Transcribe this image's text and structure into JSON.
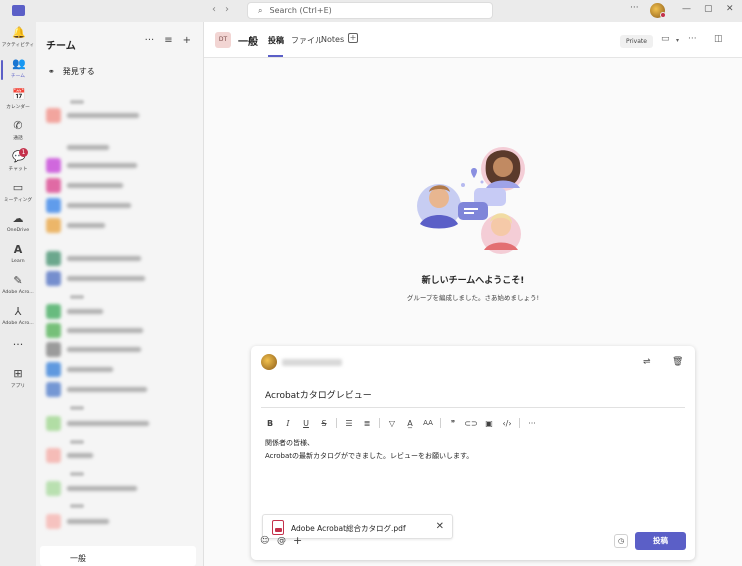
{
  "search": {
    "placeholder": "Search (Ctrl+E)"
  },
  "window": {
    "more": "···",
    "minimize": "—",
    "maximize": "▢",
    "close": "✕"
  },
  "appbar": [
    {
      "label": "アクティビティ",
      "icon": "bell-icon",
      "glyph": "🔔"
    },
    {
      "label": "チーム",
      "icon": "teams-icon",
      "glyph": "👥",
      "active": true
    },
    {
      "label": "カレンダー",
      "icon": "calendar-icon",
      "glyph": "📅"
    },
    {
      "label": "通話",
      "icon": "phone-icon",
      "glyph": "✆"
    },
    {
      "label": "チャット",
      "icon": "chat-icon",
      "glyph": "💬",
      "badge": "1"
    },
    {
      "label": "ミーティング",
      "icon": "video-icon",
      "glyph": "▭"
    },
    {
      "label": "OneDrive",
      "icon": "cloud-icon",
      "glyph": "☁"
    },
    {
      "label": "Learn",
      "icon": "learn-icon",
      "glyph": "A"
    },
    {
      "label": "Adobe Acro...",
      "icon": "adobe-acrobat-icon",
      "glyph": "✎"
    },
    {
      "label": "Adobe Acro...",
      "icon": "adobe-acrobat-icon",
      "glyph": "⅄"
    },
    {
      "label": "",
      "icon": "more-apps-icon",
      "glyph": "···"
    },
    {
      "label": "アプリ",
      "icon": "apps-icon",
      "glyph": "⊞"
    }
  ],
  "teams_panel": {
    "title": "チーム",
    "more": "···",
    "filter": "≡",
    "add": "+",
    "discover": "発見する",
    "selected_channel": "一般"
  },
  "header": {
    "initials": "DT",
    "channel": "一般",
    "tabs": [
      "投稿",
      "ファイル",
      "Notes"
    ],
    "tab_add": "+",
    "private": "Private"
  },
  "welcome": {
    "title": "新しいチームへようこそ!",
    "subtitle": "グループを編成しました。さあ始めましょう!"
  },
  "compose": {
    "subject": "Acrobatカタログレビュー",
    "body_line1": "関係者の皆様、",
    "body_line2": "Acrobatの最新カタログができました。レビューをお願いします。",
    "attachment": "Adobe Acrobat総合カタログ.pdf",
    "post_label": "投稿"
  },
  "colors": {
    "accent": "#5b5fc7",
    "badge": "#c4314b"
  }
}
